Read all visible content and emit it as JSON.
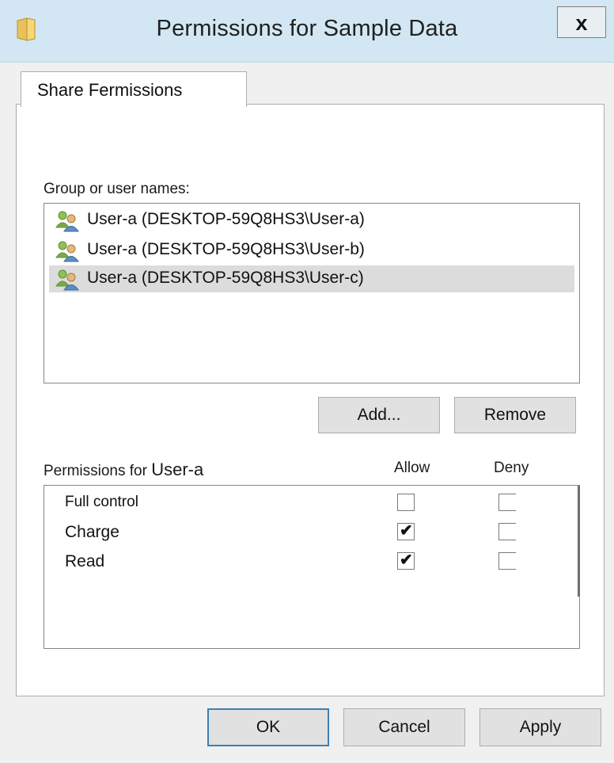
{
  "window": {
    "title": "Permissions for Sample Data",
    "close_label": "x"
  },
  "tabs": [
    {
      "label": "Share Fermissions"
    }
  ],
  "group_section": {
    "label": "Group or user names:",
    "users": [
      {
        "name": "User-a (DESKTOP-59Q8HS3\\User-a)",
        "icon": "users-icon",
        "selected": false
      },
      {
        "name": "User-a (DESKTOP-59Q8HS3\\User-b)",
        "icon": "users-icon",
        "selected": false
      },
      {
        "name": "User-a (DESKTOP-59Q8HS3\\User-c)",
        "icon": "users-icon",
        "selected": true
      }
    ],
    "add_label": "Add...",
    "remove_label": "Remove"
  },
  "permissions": {
    "label": "Permissions for",
    "user": "User-a",
    "allow_header": "Allow",
    "deny_header": "Deny",
    "rows": [
      {
        "name": "Full control",
        "allow": false,
        "deny": false
      },
      {
        "name": "Charge",
        "allow": true,
        "deny": false
      },
      {
        "name": "Read",
        "allow": true,
        "deny": false
      }
    ]
  },
  "footer": {
    "ok_label": "OK",
    "cancel_label": "Cancel",
    "apply_label": "Apply"
  },
  "colors": {
    "titlebar": "#d2e7f3",
    "selection": "#dcdcdc",
    "default_button_border": "#3c7fb1"
  }
}
